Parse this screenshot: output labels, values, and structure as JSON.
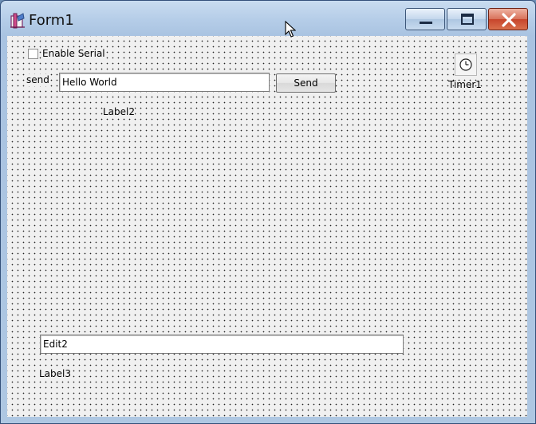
{
  "window": {
    "title": "Form1"
  },
  "titlebar": {
    "buttons": [
      "minimize",
      "maximize",
      "close"
    ]
  },
  "form": {
    "checkbox": {
      "label": "Enable Serial",
      "checked": false
    },
    "send_label": "send",
    "send_edit_value": "Hello World",
    "send_button_label": "Send",
    "label2": "Label2",
    "timer_label": "Timer1",
    "edit2_value": "Edit2",
    "label3": "Label3"
  },
  "icons": [
    "app-icon",
    "minimize-icon",
    "maximize-icon",
    "close-icon",
    "timer-icon"
  ]
}
